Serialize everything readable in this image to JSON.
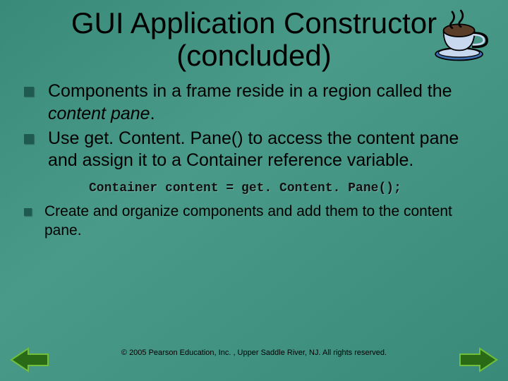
{
  "title": "GUI Application Constructor (concluded)",
  "bullets": [
    {
      "pre": "Components in a frame reside in a region called the ",
      "em": "content pane",
      "post": "."
    },
    {
      "pre": "Use get. Content. Pane() to access the content pane and assign it to a Container reference variable.",
      "em": "",
      "post": ""
    }
  ],
  "code": "Container content = get. Content. Pane();",
  "bullet3": "Create and organize components and add them to the content pane.",
  "footer": "© 2005 Pearson Education, Inc. , Upper Saddle River, NJ.  All rights reserved."
}
